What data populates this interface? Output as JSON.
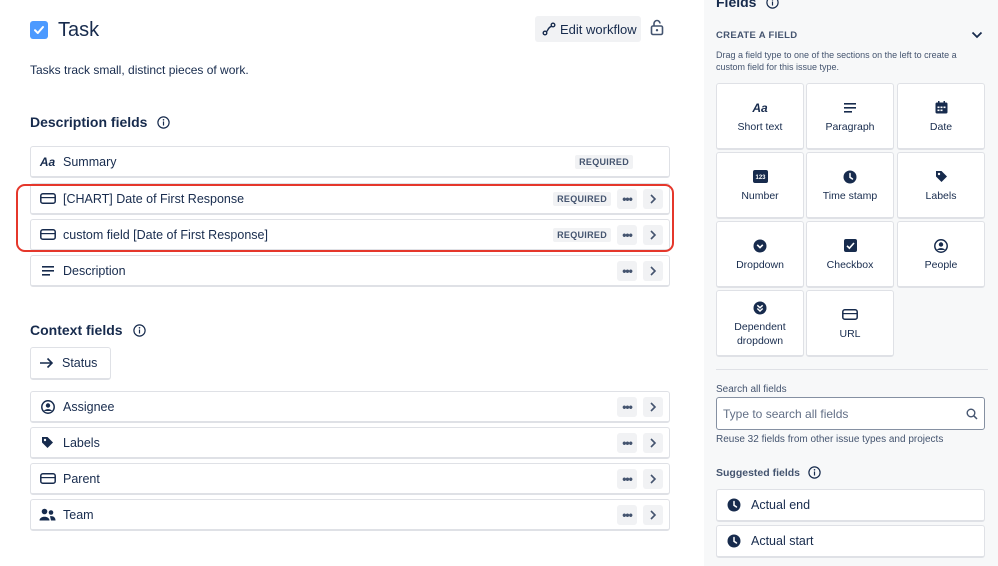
{
  "header": {
    "title": "Task",
    "edit_workflow_label": "Edit workflow",
    "description": "Tasks track small, distinct pieces of work."
  },
  "description_section": {
    "title": "Description fields",
    "fields": [
      {
        "icon": "text-aa-icon",
        "label": "Summary",
        "badge": "REQUIRED",
        "actions": false
      },
      {
        "icon": "field-box-icon",
        "label": "[CHART] Date of First Response",
        "badge": "REQUIRED",
        "actions": true
      },
      {
        "icon": "field-box-icon",
        "label": "custom field [Date of First Response]",
        "badge": "REQUIRED",
        "actions": true
      },
      {
        "icon": "lines-icon",
        "label": "Description",
        "badge": "",
        "actions": true
      }
    ]
  },
  "context_section": {
    "title": "Context fields",
    "status_label": "Status",
    "fields": [
      {
        "icon": "person-circle-icon",
        "label": "Assignee"
      },
      {
        "icon": "tag-icon",
        "label": "Labels"
      },
      {
        "icon": "field-box-icon",
        "label": "Parent"
      },
      {
        "icon": "people-icon",
        "label": "Team"
      }
    ]
  },
  "sidebar": {
    "title": "Fields",
    "create_heading": "CREATE A FIELD",
    "create_desc": "Drag a field type to one of the sections on the left to create a custom field for this issue type.",
    "tiles": [
      {
        "icon": "text-aa-icon",
        "label": "Short text"
      },
      {
        "icon": "paragraph-icon",
        "label": "Paragraph"
      },
      {
        "icon": "calendar-icon",
        "label": "Date"
      },
      {
        "icon": "number-icon",
        "label": "Number"
      },
      {
        "icon": "clock-icon",
        "label": "Time stamp"
      },
      {
        "icon": "tag-icon",
        "label": "Labels"
      },
      {
        "icon": "chevron-circle-icon",
        "label": "Dropdown"
      },
      {
        "icon": "checkbox-icon",
        "label": "Checkbox"
      },
      {
        "icon": "person-circle-icon",
        "label": "People"
      },
      {
        "icon": "double-chevron-circle-icon",
        "label": "Dependent dropdown"
      },
      {
        "icon": "field-box-icon",
        "label": "URL"
      }
    ],
    "search_label": "Search all fields",
    "search_placeholder": "Type to search all fields",
    "reuse_text": "Reuse 32 fields from other issue types and projects",
    "suggested_title": "Suggested fields",
    "suggested": [
      {
        "icon": "clock-icon",
        "label": "Actual end"
      },
      {
        "icon": "clock-icon",
        "label": "Actual start"
      }
    ]
  },
  "colors": {
    "accent": "#4c9aff",
    "highlight": "#e5372b",
    "text": "#172b4d",
    "subtle": "#44546f",
    "panel_bg": "#f7f8f9"
  }
}
